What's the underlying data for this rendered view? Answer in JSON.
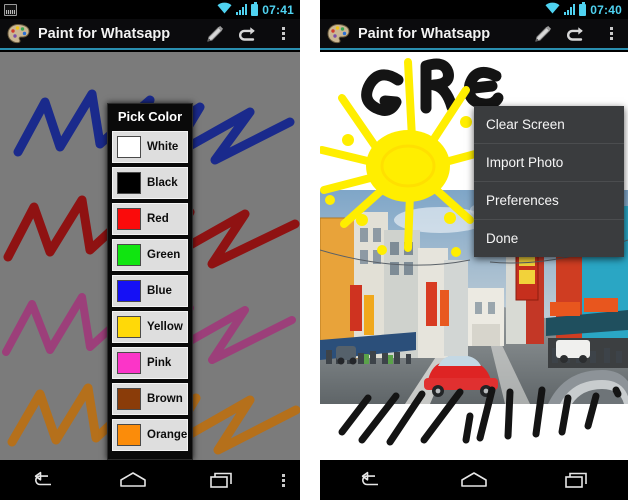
{
  "app": {
    "title": "Paint for Whatsapp",
    "accent_color": "#2a8fb0",
    "icon": "palette-icon"
  },
  "left_phone": {
    "statusbar": {
      "time": "07:41",
      "icons": [
        "photo-notification-icon",
        "wifi-icon",
        "signal-icon",
        "battery-icon"
      ]
    },
    "actionbar": {
      "title": "Paint for Whatsapp",
      "buttons": [
        "pencil-icon",
        "undo-icon",
        "overflow-icon"
      ]
    },
    "canvas": {
      "background_color": "#7b7b7b",
      "strokes": [
        {
          "color": "#1a2a8c",
          "name": "blue-zigzag"
        },
        {
          "color": "#8f1212",
          "name": "red-zigzag"
        },
        {
          "color": "#9c3f7a",
          "name": "pink-zigzag"
        },
        {
          "color": "#b5701b",
          "name": "orange-zigzag"
        }
      ]
    },
    "dialog": {
      "title": "Pick Color",
      "colors": [
        {
          "label": "White",
          "hex": "#ffffff"
        },
        {
          "label": "Black",
          "hex": "#000000"
        },
        {
          "label": "Red",
          "hex": "#fa0b0b"
        },
        {
          "label": "Green",
          "hex": "#10e510"
        },
        {
          "label": "Blue",
          "hex": "#1510f5"
        },
        {
          "label": "Yellow",
          "hex": "#ffd908"
        },
        {
          "label": "Pink",
          "hex": "#fb35c8"
        },
        {
          "label": "Brown",
          "hex": "#8a3c09"
        },
        {
          "label": "Orange",
          "hex": "#fb8c0a"
        }
      ]
    },
    "navbar": {
      "buttons": [
        "back-icon",
        "home-icon",
        "recents-icon",
        "menu-dots-icon"
      ]
    }
  },
  "right_phone": {
    "statusbar": {
      "time": "07:40",
      "icons": [
        "wifi-icon",
        "signal-icon",
        "battery-icon"
      ]
    },
    "actionbar": {
      "title": "Paint for Whatsapp",
      "buttons": [
        "pencil-icon",
        "undo-icon",
        "overflow-icon"
      ]
    },
    "canvas": {
      "background_color": "#ffffff",
      "text_drawing": "GRE",
      "sun_color": "#ffee00",
      "photo_caption": "chinatown-street-photo",
      "stroke_color": "#111111"
    },
    "menu": {
      "items": [
        {
          "label": "Clear Screen"
        },
        {
          "label": "Import Photo"
        },
        {
          "label": "Preferences"
        },
        {
          "label": "Done"
        }
      ]
    },
    "navbar": {
      "buttons": [
        "back-icon",
        "home-icon",
        "recents-icon"
      ]
    }
  }
}
